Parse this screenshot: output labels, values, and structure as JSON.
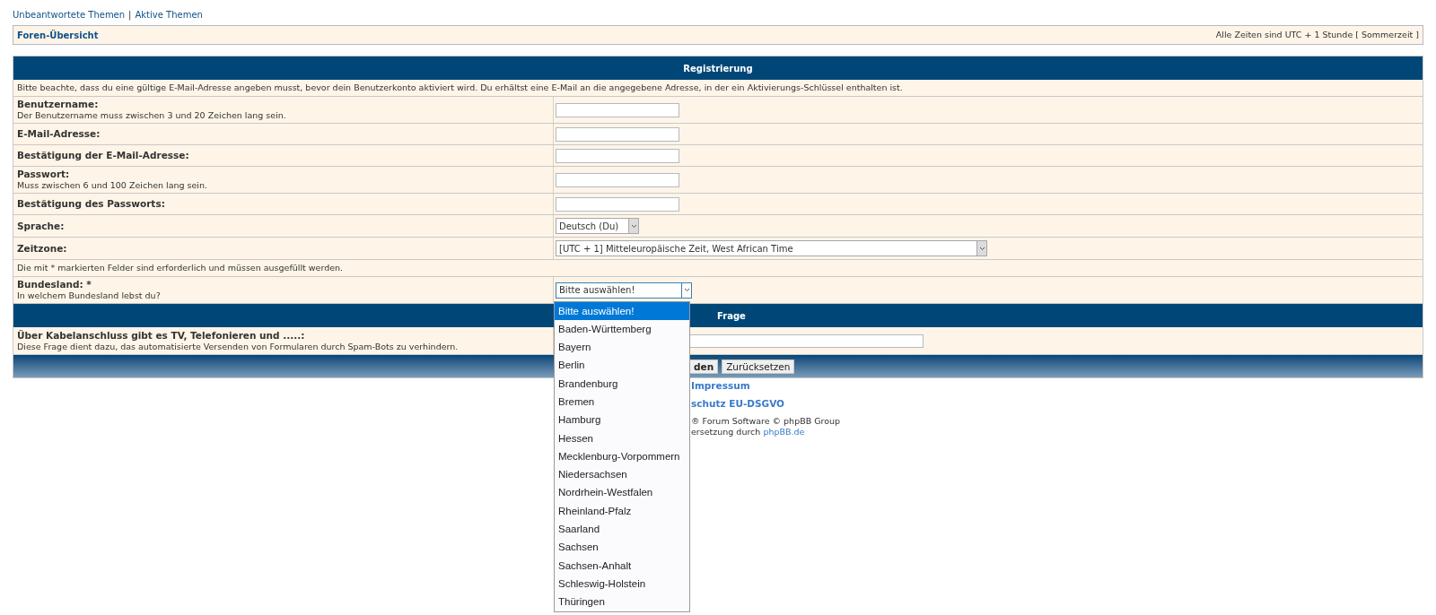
{
  "top_links": [
    "Unbeantwortete Themen",
    "|",
    "Aktive Themen"
  ],
  "nav_bar": {
    "breadcrumb": "Foren-Übersicht",
    "timezone_note": "Alle Zeiten sind UTC + 1 Stunde [ Sommerzeit ]"
  },
  "registration": {
    "title": "Registrierung",
    "intro": "Bitte beachte, dass du eine gültige E-Mail-Adresse angeben musst, bevor dein Benutzerkonto aktiviert wird. Du erhältst eine E-Mail an die angegebene Adresse, in der ein Aktivierungs-Schlüssel enthalten ist.",
    "rows": [
      {
        "kind": "input",
        "label": "Benutzername:",
        "hint": "Der Benutzername muss zwischen 3 und 20 Zeichen lang sein."
      },
      {
        "kind": "input",
        "label": "E-Mail-Adresse:"
      },
      {
        "kind": "input",
        "label": "Bestätigung der E-Mail-Adresse:"
      },
      {
        "kind": "input",
        "label": "Passwort:",
        "hint": "Muss zwischen 6 und 100 Zeichen lang sein."
      },
      {
        "kind": "input",
        "label": "Bestätigung des Passworts:"
      },
      {
        "kind": "select",
        "label": "Sprache:",
        "value": "Deutsch (Du)"
      },
      {
        "kind": "wide_select",
        "label": "Zeitzone:",
        "value": "[UTC + 1] Mitteleuropäische Zeit, West African Time"
      },
      {
        "kind": "note",
        "label": "Die mit * markierten Felder sind erforderlich und müssen ausgefüllt werden."
      },
      {
        "kind": "dropdown",
        "label": "Bundesland: *",
        "hint": "In welchem Bundesland lebst du?",
        "value": "Bitte auswählen!",
        "expanded": true
      }
    ]
  },
  "question": {
    "title": "Frage",
    "label": "Über Kabelanschluss gibt es TV, Telefonieren und .....:",
    "hint": "Diese Frage dient dazu, das automatisierte Versenden von Formularen durch Spam-Bots zu verhindern."
  },
  "buttons": [
    "den",
    "Zurücksetzen"
  ],
  "footer": [
    {
      "kind": "link",
      "text": "Impressum"
    },
    {
      "kind": "link",
      "text": "schutz EU-DSGVO"
    },
    {
      "kind": "text",
      "text": "® Forum Software © phpBB Group"
    },
    {
      "kind": "mixed",
      "text": "ersetzung durch",
      "link": "phpBB.de"
    }
  ],
  "dropdown_options": [
    {
      "label": "Bitte auswählen!",
      "selected": true
    },
    {
      "label": "Baden-Württemberg",
      "selected": false
    },
    {
      "label": "Bayern",
      "selected": false
    },
    {
      "label": "Berlin",
      "selected": false
    },
    {
      "label": "Brandenburg",
      "selected": false
    },
    {
      "label": "Bremen",
      "selected": false
    },
    {
      "label": "Hamburg",
      "selected": false
    },
    {
      "label": "Hessen",
      "selected": false
    },
    {
      "label": "Mecklenburg-Vorpommern",
      "selected": false
    },
    {
      "label": "Niedersachsen",
      "selected": false
    },
    {
      "label": "Nordrhein-Westfalen",
      "selected": false
    },
    {
      "label": "Rheinland-Pfalz",
      "selected": false
    },
    {
      "label": "Saarland",
      "selected": false
    },
    {
      "label": "Sachsen",
      "selected": false
    },
    {
      "label": "Sachsen-Anhalt",
      "selected": false
    },
    {
      "label": "Schleswig-Holstein",
      "selected": false
    },
    {
      "label": "Thüringen",
      "selected": false
    }
  ]
}
